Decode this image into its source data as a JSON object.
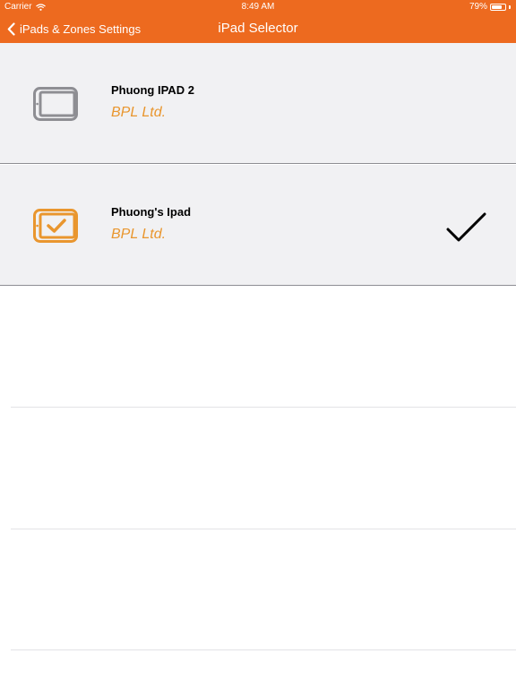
{
  "status_bar": {
    "carrier": "Carrier",
    "time": "8:49 AM",
    "battery_percent": "79%"
  },
  "nav": {
    "back_label": "iPads & Zones Settings",
    "title": "iPad Selector"
  },
  "devices": [
    {
      "name": "Phuong IPAD 2",
      "company": "BPL Ltd.",
      "selected": false,
      "icon": "ipad-icon"
    },
    {
      "name": "Phuong's Ipad",
      "company": "BPL Ltd.",
      "selected": true,
      "icon": "ipad-checked-icon"
    }
  ],
  "colors": {
    "accent": "#ED6A1F",
    "company_text": "#E9962E",
    "icon_gray": "#8E8E93",
    "icon_selected": "#E9962E",
    "row_bg": "#F1F1F3"
  }
}
